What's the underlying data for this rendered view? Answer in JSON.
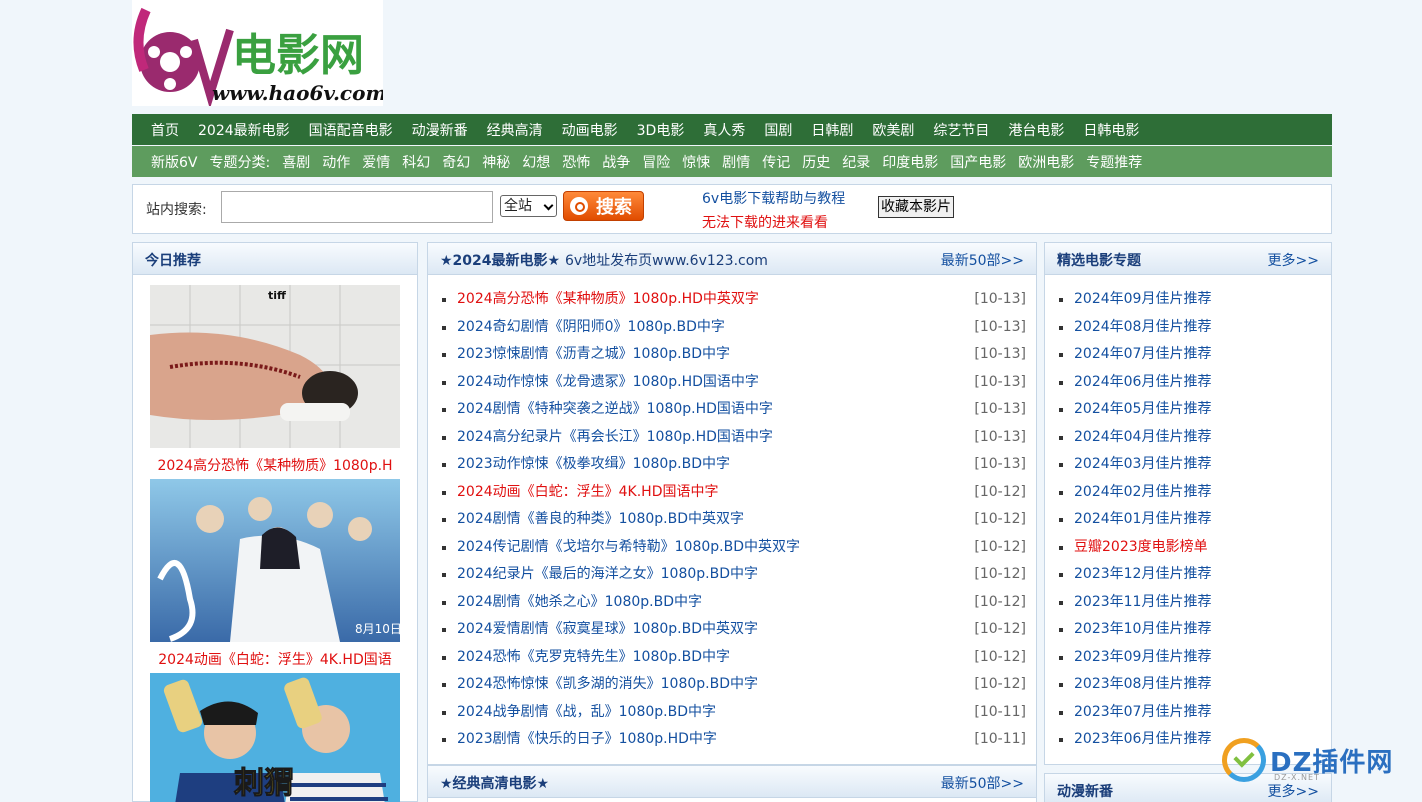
{
  "logo": {
    "text": "6v电影网",
    "url_text": "www.hao6v.com"
  },
  "nav_primary": [
    "首页",
    "2024最新电影",
    "国语配音电影",
    "动漫新番",
    "经典高清",
    "动画电影",
    "3D电影",
    "真人秀",
    "国剧",
    "日韩剧",
    "欧美剧",
    "综艺节目",
    "港台电影",
    "日韩电影"
  ],
  "nav_secondary": [
    "新版6V",
    "专题分类:",
    "喜剧",
    "动作",
    "爱情",
    "科幻",
    "奇幻",
    "神秘",
    "幻想",
    "恐怖",
    "战争",
    "冒险",
    "惊悚",
    "剧情",
    "传记",
    "历史",
    "纪录",
    "印度电影",
    "国产电影",
    "欧洲电影",
    "专题推荐"
  ],
  "search": {
    "label": "站内搜索:",
    "scope": "全站",
    "button": "搜索",
    "help_link": "6v电影下载帮助与教程",
    "trouble_link": "无法下载的进来看看",
    "bookmark": "收藏本影片"
  },
  "today": {
    "title": "今日推荐",
    "items": [
      {
        "caption": "2024高分恐怖《某种物质》1080p.H",
        "badge": "tiff"
      },
      {
        "caption": "2024动画《白蛇：浮生》4K.HD国语",
        "badge": "8月10日"
      },
      {
        "caption": "",
        "badge": "刺猬"
      }
    ]
  },
  "latest": {
    "title": "★2024最新电影★",
    "subtitle": "6v地址发布页www.6v123.com",
    "more": "最新50部>>",
    "items": [
      {
        "title": "2024高分恐怖《某种物质》1080p.HD中英双字",
        "date": "[10-13]",
        "hot": true
      },
      {
        "title": "2024奇幻剧情《阴阳师0》1080p.BD中字",
        "date": "[10-13]",
        "hot": false
      },
      {
        "title": "2023惊悚剧情《沥青之城》1080p.BD中字",
        "date": "[10-13]",
        "hot": false
      },
      {
        "title": "2024动作惊悚《龙骨遗冢》1080p.HD国语中字",
        "date": "[10-13]",
        "hot": false
      },
      {
        "title": "2024剧情《特种突袭之逆战》1080p.HD国语中字",
        "date": "[10-13]",
        "hot": false
      },
      {
        "title": "2024高分纪录片《再会长江》1080p.HD国语中字",
        "date": "[10-13]",
        "hot": false
      },
      {
        "title": "2023动作惊悚《极拳攻缉》1080p.BD中字",
        "date": "[10-13]",
        "hot": false
      },
      {
        "title": "2024动画《白蛇：浮生》4K.HD国语中字",
        "date": "[10-12]",
        "hot": true
      },
      {
        "title": "2024剧情《善良的种类》1080p.BD中英双字",
        "date": "[10-12]",
        "hot": false
      },
      {
        "title": "2024传记剧情《戈培尔与希特勒》1080p.BD中英双字",
        "date": "[10-12]",
        "hot": false
      },
      {
        "title": "2024纪录片《最后的海洋之女》1080p.BD中字",
        "date": "[10-12]",
        "hot": false
      },
      {
        "title": "2024剧情《她杀之心》1080p.BD中字",
        "date": "[10-12]",
        "hot": false
      },
      {
        "title": "2024爱情剧情《寂寞星球》1080p.BD中英双字",
        "date": "[10-12]",
        "hot": false
      },
      {
        "title": "2024恐怖《克罗克特先生》1080p.BD中字",
        "date": "[10-12]",
        "hot": false
      },
      {
        "title": "2024恐怖惊悚《凯多湖的消失》1080p.BD中字",
        "date": "[10-12]",
        "hot": false
      },
      {
        "title": "2024战争剧情《战，乱》1080p.BD中字",
        "date": "[10-11]",
        "hot": false
      },
      {
        "title": "2023剧情《快乐的日子》1080p.HD中字",
        "date": "[10-11]",
        "hot": false
      }
    ]
  },
  "classic": {
    "title": "★经典高清电影★",
    "more": "最新50部>>"
  },
  "topics": {
    "title": "精选电影专题",
    "more": "更多>>",
    "items": [
      {
        "title": "2024年09月佳片推荐",
        "hot": false
      },
      {
        "title": "2024年08月佳片推荐",
        "hot": false
      },
      {
        "title": "2024年07月佳片推荐",
        "hot": false
      },
      {
        "title": "2024年06月佳片推荐",
        "hot": false
      },
      {
        "title": "2024年05月佳片推荐",
        "hot": false
      },
      {
        "title": "2024年04月佳片推荐",
        "hot": false
      },
      {
        "title": "2024年03月佳片推荐",
        "hot": false
      },
      {
        "title": "2024年02月佳片推荐",
        "hot": false
      },
      {
        "title": "2024年01月佳片推荐",
        "hot": false
      },
      {
        "title": "豆瓣2023度电影榜单",
        "hot": true
      },
      {
        "title": "2023年12月佳片推荐",
        "hot": false
      },
      {
        "title": "2023年11月佳片推荐",
        "hot": false
      },
      {
        "title": "2023年10月佳片推荐",
        "hot": false
      },
      {
        "title": "2023年09月佳片推荐",
        "hot": false
      },
      {
        "title": "2023年08月佳片推荐",
        "hot": false
      },
      {
        "title": "2023年07月佳片推荐",
        "hot": false
      },
      {
        "title": "2023年06月佳片推荐",
        "hot": false
      }
    ]
  },
  "anime": {
    "title": "动漫新番",
    "more": "更多>>"
  },
  "watermark": {
    "text": "DZ插件网",
    "sub": "DZ-X.NET"
  },
  "colors": {
    "nav_dark": "#2e6e37",
    "nav_light": "#5e9c5e",
    "link": "#1450a0",
    "hot": "#e01010",
    "bg": "#f0f6fb"
  }
}
